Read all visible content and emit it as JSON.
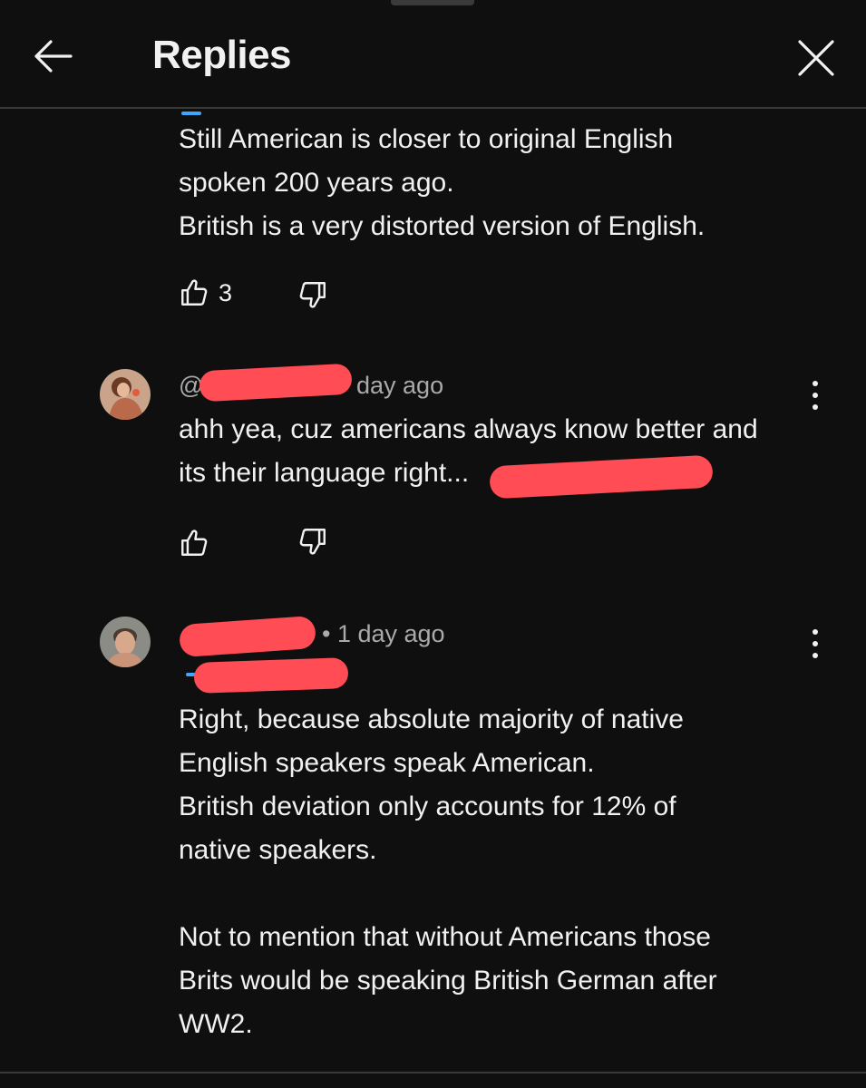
{
  "header": {
    "title": "Replies",
    "back_icon": "arrow-left-icon",
    "close_icon": "close-icon"
  },
  "comments": [
    {
      "lines": [
        "Still American is closer to original English",
        "spoken 200 years ago.",
        "British is a very distorted version of English."
      ],
      "likes": "3"
    },
    {
      "handle_prefix": "@",
      "time": "day ago",
      "lines": [
        "ahh yea, cuz americans always know better and",
        "its their language right..."
      ],
      "likes": ""
    },
    {
      "time": "• 1 day ago",
      "lines": [
        "Right, because absolute majority of native",
        "English speakers speak American.",
        "British deviation only accounts for 12% of",
        "native speakers.",
        "",
        "Not to mention that without Americans those",
        "Brits would be speaking British German after",
        "WW2."
      ]
    }
  ],
  "colors": {
    "background": "#0f0f0f",
    "text": "#f1f1f1",
    "meta": "#aaaaaa",
    "redaction": "#ff4c55",
    "mention": "#3ea6ff"
  }
}
